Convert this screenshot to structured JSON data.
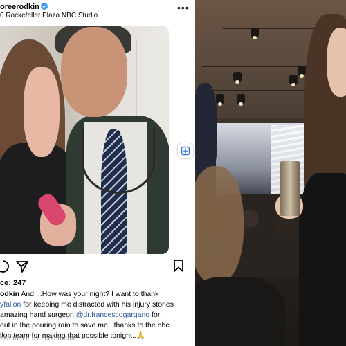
{
  "post": {
    "username": "oreerodkin",
    "location": "0 Rockefeller Plaza NBC Studio",
    "likes": "ce: 247",
    "caption_lines": [
      {
        "user": "odkin",
        "text": " And ...How was your night? I want to thank"
      },
      {
        "mention": "yfallon",
        "text": " for keeping me distracted with his injury stories"
      },
      {
        "text": "amazing hand surgeon ",
        "mention": "@dr.francescogargano",
        "text2": " for"
      },
      {
        "text": "out in the pouring rain to save me.. thanks to the nbc"
      },
      {
        "text": "llon team for making that possible tonight..🙏"
      }
    ],
    "comments_link": "zza tutti e 31 i commenti"
  },
  "icons": {
    "more": "more-icon",
    "comment": "comment-icon",
    "share": "share-icon",
    "bookmark": "bookmark-icon",
    "save_chip": "download-icon",
    "verified": "verified-badge-icon"
  },
  "colors": {
    "verified": "#3897f0",
    "mention": "#2a5a9a",
    "muted": "#8e8e8e"
  }
}
